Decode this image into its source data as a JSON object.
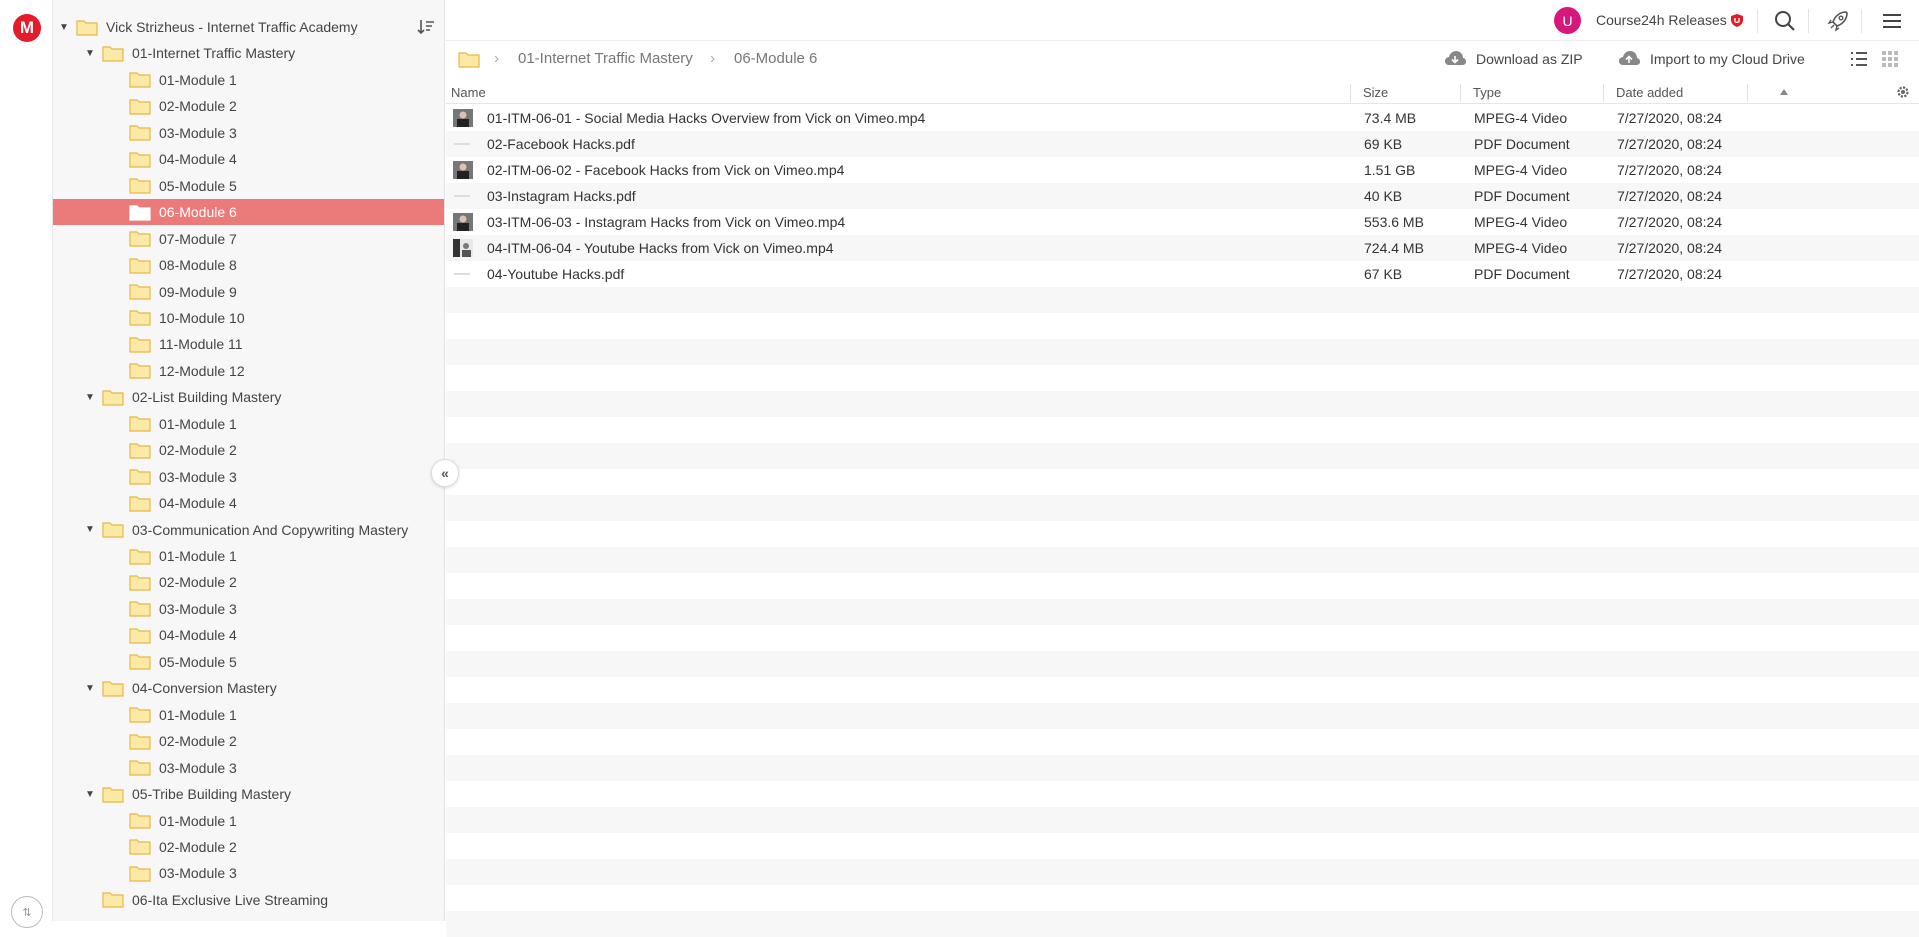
{
  "app": {
    "logo_letter": "M"
  },
  "account": {
    "avatar_letter": "U",
    "name": "Course24h Releases"
  },
  "tree": [
    {
      "label": "Vick Strizheus - Internet Traffic Academy",
      "level": 0,
      "expanded": true,
      "selected": false
    },
    {
      "label": "01-Internet Traffic Mastery",
      "level": 1,
      "expanded": true,
      "selected": false
    },
    {
      "label": "01-Module 1",
      "level": 2,
      "selected": false
    },
    {
      "label": "02-Module 2",
      "level": 2,
      "selected": false
    },
    {
      "label": "03-Module 3",
      "level": 2,
      "selected": false
    },
    {
      "label": "04-Module 4",
      "level": 2,
      "selected": false
    },
    {
      "label": "05-Module 5",
      "level": 2,
      "selected": false
    },
    {
      "label": "06-Module 6",
      "level": 2,
      "selected": true
    },
    {
      "label": "07-Module 7",
      "level": 2,
      "selected": false
    },
    {
      "label": "08-Module 8",
      "level": 2,
      "selected": false
    },
    {
      "label": "09-Module 9",
      "level": 2,
      "selected": false
    },
    {
      "label": "10-Module 10",
      "level": 2,
      "selected": false
    },
    {
      "label": "11-Module 11",
      "level": 2,
      "selected": false
    },
    {
      "label": "12-Module 12",
      "level": 2,
      "selected": false
    },
    {
      "label": "02-List Building Mastery",
      "level": 1,
      "expanded": true,
      "selected": false
    },
    {
      "label": "01-Module 1",
      "level": 2,
      "selected": false
    },
    {
      "label": "02-Module 2",
      "level": 2,
      "selected": false
    },
    {
      "label": "03-Module 3",
      "level": 2,
      "selected": false
    },
    {
      "label": "04-Module 4",
      "level": 2,
      "selected": false
    },
    {
      "label": "03-Communication And Copywriting Mastery",
      "level": 1,
      "expanded": true,
      "selected": false
    },
    {
      "label": "01-Module 1",
      "level": 2,
      "selected": false
    },
    {
      "label": "02-Module 2",
      "level": 2,
      "selected": false
    },
    {
      "label": "03-Module 3",
      "level": 2,
      "selected": false
    },
    {
      "label": "04-Module 4",
      "level": 2,
      "selected": false
    },
    {
      "label": "05-Module 5",
      "level": 2,
      "selected": false
    },
    {
      "label": "04-Conversion Mastery",
      "level": 1,
      "expanded": true,
      "selected": false
    },
    {
      "label": "01-Module 1",
      "level": 2,
      "selected": false
    },
    {
      "label": "02-Module 2",
      "level": 2,
      "selected": false
    },
    {
      "label": "03-Module 3",
      "level": 2,
      "selected": false
    },
    {
      "label": "05-Tribe Building Mastery",
      "level": 1,
      "expanded": true,
      "selected": false
    },
    {
      "label": "01-Module 1",
      "level": 2,
      "selected": false
    },
    {
      "label": "02-Module 2",
      "level": 2,
      "selected": false
    },
    {
      "label": "03-Module 3",
      "level": 2,
      "selected": false
    },
    {
      "label": "06-Ita Exclusive Live Streaming",
      "level": 1,
      "expanded": false,
      "selected": false
    }
  ],
  "breadcrumb": [
    "01-Internet Traffic Mastery",
    "06-Module 6"
  ],
  "actions": {
    "download_zip": "Download as ZIP",
    "import_cloud": "Import to my Cloud Drive"
  },
  "columns": {
    "name": "Name",
    "size": "Size",
    "type": "Type",
    "date": "Date added"
  },
  "files": [
    {
      "name": "01-ITM-06-01 - Social Media Hacks Overview from Vick on Vimeo.mp4",
      "size": "73.4 MB",
      "type": "MPEG-4 Video",
      "date": "7/27/2020, 08:24",
      "kind": "video"
    },
    {
      "name": "02-Facebook Hacks.pdf",
      "size": "69 KB",
      "type": "PDF Document",
      "date": "7/27/2020, 08:24",
      "kind": "pdf"
    },
    {
      "name": "02-ITM-06-02 - Facebook Hacks from Vick on Vimeo.mp4",
      "size": "1.51 GB",
      "type": "MPEG-4 Video",
      "date": "7/27/2020, 08:24",
      "kind": "video"
    },
    {
      "name": "03-Instagram Hacks.pdf",
      "size": "40 KB",
      "type": "PDF Document",
      "date": "7/27/2020, 08:24",
      "kind": "pdf"
    },
    {
      "name": "03-ITM-06-03 - Instagram Hacks from Vick on Vimeo.mp4",
      "size": "553.6 MB",
      "type": "MPEG-4 Video",
      "date": "7/27/2020, 08:24",
      "kind": "video"
    },
    {
      "name": "04-ITM-06-04 - Youtube Hacks from Vick on Vimeo.mp4",
      "size": "724.4 MB",
      "type": "MPEG-4 Video",
      "date": "7/27/2020, 08:24",
      "kind": "video2"
    },
    {
      "name": "04-Youtube Hacks.pdf",
      "size": "67 KB",
      "type": "PDF Document",
      "date": "7/27/2020, 08:24",
      "kind": "pdf"
    }
  ],
  "colors": {
    "brand": "#e51a2b",
    "selected": "#eb7a7a",
    "folder": "#fde9a6",
    "folder_stroke": "#e6b84a",
    "avatar": "#d6177c"
  }
}
